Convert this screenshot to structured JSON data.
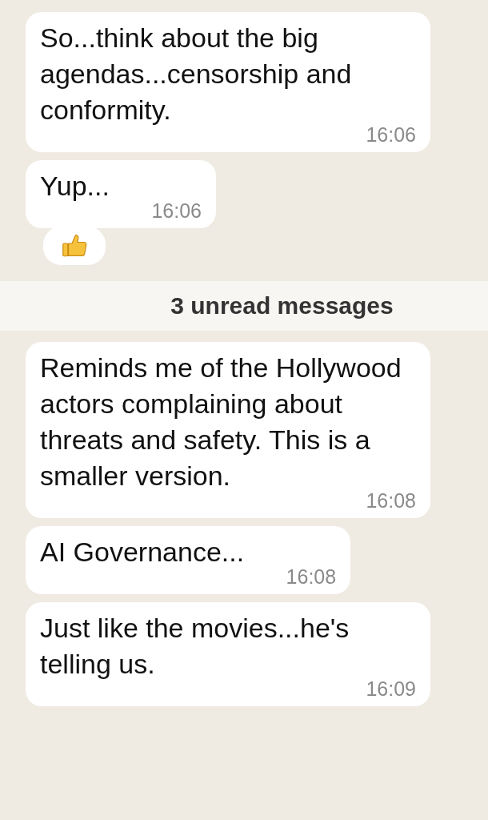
{
  "messages_before": [
    {
      "text": "So...think about the big agendas...censorship and conformity.",
      "time": "16:06"
    },
    {
      "text": "Yup...",
      "time": "16:06",
      "reacted": true
    }
  ],
  "unread_banner": {
    "text": "3 unread messages"
  },
  "messages_after": [
    {
      "text": "Reminds me of the Hollywood actors complaining about threats and safety. This is a smaller version.",
      "time": "16:08"
    },
    {
      "text": "AI Governance...",
      "time": "16:08"
    },
    {
      "text": "Just like the movies...he's telling us.",
      "time": "16:09"
    }
  ]
}
